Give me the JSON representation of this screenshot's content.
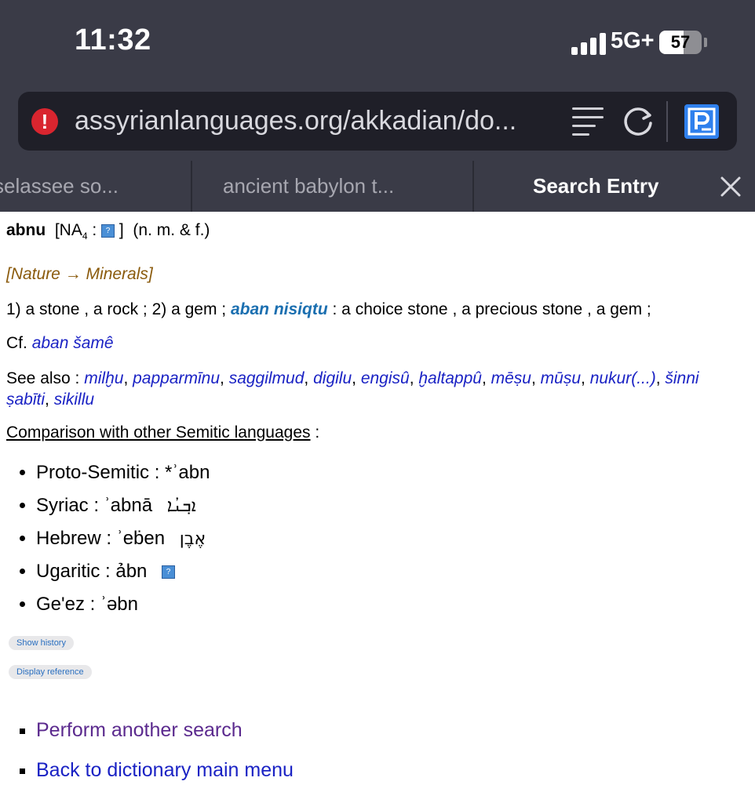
{
  "status_bar": {
    "time": "11:32",
    "network": "5G+",
    "battery_percent": 57,
    "battery_label": "57"
  },
  "browser": {
    "url": "assyrianlanguages.org/akkadian/do...",
    "tabs": [
      {
        "title": "selassee so..."
      },
      {
        "title": "ancient babylon t..."
      },
      {
        "title": "Search Entry",
        "active": true
      }
    ]
  },
  "entry": {
    "word": "abnu",
    "sumerogram_prefix": "[NA",
    "sumerogram_sub": "4",
    "sumerogram_colon": " :",
    "sumerogram_close": "]",
    "grammar": "(n. m. & f.)",
    "category": "[Nature → Minerals]",
    "meaning_start": "1) a stone , a rock ; 2) a gem ;",
    "meaning_link": "aban nisiqtu",
    "meaning_end": ": a choice stone , a precious stone , a gem ;",
    "cf_label": "Cf.",
    "cf_link": "aban šamê",
    "see_also_label": "See also :",
    "see_also": [
      "milḫu",
      "papparmīnu",
      "saggilmud",
      "digilu",
      "engisû",
      "ḫaltappû",
      "mēṣu",
      "mūṣu",
      "nukur(...)",
      "šinni ṣabīti",
      "sikillu"
    ],
    "comparison_title": "Comparison with other Semitic languages",
    "comparison_colon": ":",
    "comparisons": [
      {
        "lang": "Proto-Semitic :",
        "form": "*ʾabn",
        "native": ""
      },
      {
        "lang": "Syriac :",
        "form": "ʾabnā",
        "native": "ܐܒ݂ܢܳܐ"
      },
      {
        "lang": "Hebrew :",
        "form": "ʾeḃen",
        "native": "אֶבֶן"
      },
      {
        "lang": "Ugaritic :",
        "form": "ảbn",
        "native": ""
      },
      {
        "lang": "Ge'ez :",
        "form": "ʾəbn",
        "native": ""
      }
    ],
    "show_history": "Show history",
    "display_reference": "Display reference"
  },
  "footer_links": {
    "another_search": "Perform another search",
    "main_menu": "Back to dictionary main menu"
  },
  "colors": {
    "chrome_bg": "#3a3b47",
    "urlbar_bg": "#1f1f28",
    "warning": "#d9252f",
    "category_text": "#8a5a0c",
    "link": "#1a22c4",
    "visited_link": "#5b2a8e"
  },
  "icons": [
    "warning-icon",
    "reader-mode-icon",
    "reload-icon",
    "extension-icon",
    "close-icon",
    "help-icon"
  ]
}
